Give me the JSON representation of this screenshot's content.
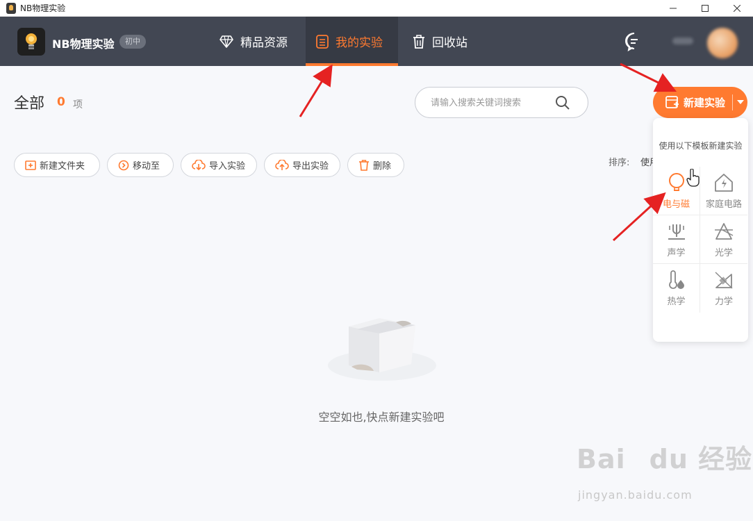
{
  "window": {
    "title": "NB物理实验",
    "controls": [
      "minimize",
      "maximize",
      "close"
    ]
  },
  "header": {
    "brand": "NB物理实验",
    "grade_badge": "初中",
    "nav": [
      {
        "label": "精品资源",
        "icon": "diamond-icon",
        "active": false
      },
      {
        "label": "我的实验",
        "icon": "notebook-icon",
        "active": true
      },
      {
        "label": "回收站",
        "icon": "trash-icon",
        "active": false
      }
    ],
    "message_icon": "chat-bubble-icon"
  },
  "main": {
    "heading": "全部",
    "count": "0",
    "count_unit": "项",
    "search": {
      "placeholder": "请输入搜索关键词搜索"
    },
    "new_button": {
      "label": "新建实验"
    },
    "toolbar": [
      {
        "label": "新建文件夹",
        "icon": "folder-plus-icon"
      },
      {
        "label": "移动至",
        "icon": "move-icon"
      },
      {
        "label": "导入实验",
        "icon": "cloud-download-icon"
      },
      {
        "label": "导出实验",
        "icon": "cloud-upload-icon"
      },
      {
        "label": "删除",
        "icon": "trash-icon"
      }
    ],
    "sort": {
      "label": "排序:",
      "value": "使用"
    },
    "empty_text": "空空如也,快点新建实验吧"
  },
  "template_panel": {
    "title": "使用以下模板新建实验",
    "templates": [
      {
        "label": "电与磁",
        "icon": "bulb-icon",
        "active": true
      },
      {
        "label": "家庭电路",
        "icon": "house-bolt-icon",
        "active": false
      },
      {
        "label": "声学",
        "icon": "tuning-fork-icon",
        "active": false
      },
      {
        "label": "光学",
        "icon": "prism-icon",
        "active": false
      },
      {
        "label": "热学",
        "icon": "thermometer-icon",
        "active": false
      },
      {
        "label": "力学",
        "icon": "incline-icon",
        "active": false
      }
    ]
  },
  "watermark": {
    "main": "Bai du 经验",
    "sub": "jingyan.baidu.com"
  },
  "colors": {
    "accent": "#ff7a30",
    "header_bg": "#424753",
    "page_bg": "#f7f8fb",
    "annotation_arrow": "#e52222"
  }
}
